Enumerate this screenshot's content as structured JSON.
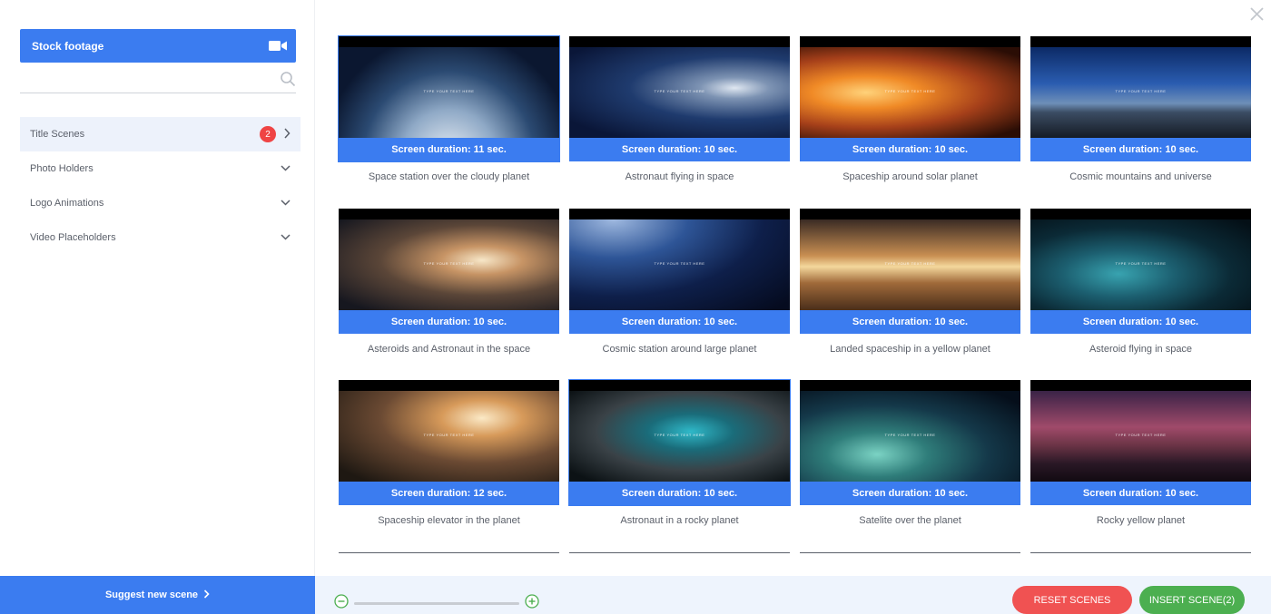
{
  "sidebar": {
    "stock_button_label": "Stock footage",
    "search_placeholder": "",
    "categories": [
      {
        "label": "Title Scenes",
        "badge": "2",
        "active": true
      },
      {
        "label": "Photo Holders"
      },
      {
        "label": "Logo Animations"
      },
      {
        "label": "Video Placeholders"
      }
    ]
  },
  "overlay_text": "TYPE YOUR TEXT HERE",
  "scenes": [
    {
      "duration": "Screen duration: 11 sec.",
      "caption": "Space station over the cloudy planet",
      "selected": true
    },
    {
      "duration": "Screen duration: 10 sec.",
      "caption": "Astronaut flying in space"
    },
    {
      "duration": "Screen duration: 10 sec.",
      "caption": "Spaceship around solar planet"
    },
    {
      "duration": "Screen duration: 10 sec.",
      "caption": "Cosmic mountains and universe"
    },
    {
      "duration": "Screen duration: 10 sec.",
      "caption": "Asteroids and Astronaut in the space"
    },
    {
      "duration": "Screen duration: 10 sec.",
      "caption": "Cosmic station around large planet"
    },
    {
      "duration": "Screen duration: 10 sec.",
      "caption": "Landed spaceship in a yellow planet"
    },
    {
      "duration": "Screen duration: 10 sec.",
      "caption": "Asteroid flying in space"
    },
    {
      "duration": "Screen duration: 12 sec.",
      "caption": "Spaceship elevator in the planet"
    },
    {
      "duration": "Screen duration: 10 sec.",
      "caption": "Astronaut in a rocky planet",
      "selected": true
    },
    {
      "duration": "Screen duration: 10 sec.",
      "caption": "Satelite over the planet"
    },
    {
      "duration": "Screen duration: 10 sec.",
      "caption": "Rocky yellow planet"
    }
  ],
  "footer": {
    "suggest_label": "Suggest new scene",
    "reset_label": "RESET SCENES",
    "insert_label": "INSERT SCENE(2)"
  },
  "colors": {
    "accent": "#3b7cf0",
    "reset": "#f05252",
    "insert": "#4caf50",
    "badge": "#ef4444"
  }
}
